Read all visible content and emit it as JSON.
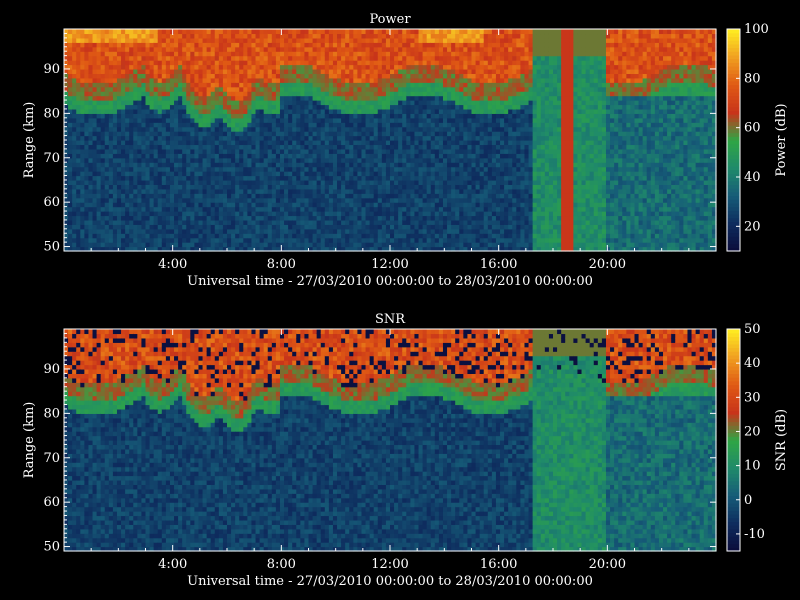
{
  "chart_data": [
    {
      "type": "heatmap",
      "title": "Power",
      "xlabel": "Universal time - 27/03/2010 00:00:00 to 28/03/2010 00:00:00",
      "ylabel": "Range (km)",
      "colorbar_label": "Power (dB)",
      "xlim_hours": [
        0,
        24
      ],
      "ylim_km": [
        49,
        99
      ],
      "x_ticks": [
        "4:00",
        "8:00",
        "12:00",
        "16:00",
        "20:00"
      ],
      "y_ticks": [
        50,
        60,
        70,
        80,
        90
      ],
      "colorbar_range": [
        10,
        100
      ],
      "colorbar_ticks": [
        20,
        40,
        60,
        80,
        100
      ],
      "colormap": [
        "#0b0b3a",
        "#0e2c5e",
        "#165c78",
        "#1f8a6a",
        "#2fa645",
        "#c8341a",
        "#e05a14",
        "#f0a020",
        "#ffee22"
      ]
    },
    {
      "type": "heatmap",
      "title": "SNR",
      "xlabel": "Universal time - 27/03/2010 00:00:00 to 28/03/2010 00:00:00",
      "ylabel": "Range (km)",
      "colorbar_label": "SNR (dB)",
      "xlim_hours": [
        0,
        24
      ],
      "ylim_km": [
        49,
        99
      ],
      "x_ticks": [
        "4:00",
        "8:00",
        "12:00",
        "16:00",
        "20:00"
      ],
      "y_ticks": [
        50,
        60,
        70,
        80,
        90
      ],
      "colorbar_range": [
        -15,
        50
      ],
      "colorbar_ticks": [
        -10,
        0,
        10,
        20,
        30,
        40,
        50
      ],
      "colormap": [
        "#0b0b3a",
        "#0e2c5e",
        "#165c78",
        "#1f8a6a",
        "#2fa645",
        "#c8341a",
        "#e05a14",
        "#f0a020",
        "#ffee22"
      ]
    }
  ]
}
